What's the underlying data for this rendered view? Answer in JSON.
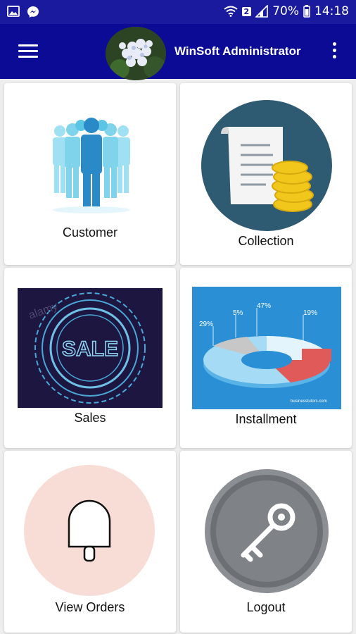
{
  "status_bar": {
    "battery": "70%",
    "time": "14:18",
    "sim_badge": "2"
  },
  "app_bar": {
    "title": "WinSoft Administrator"
  },
  "tiles": {
    "customer": {
      "label": "Customer"
    },
    "collection": {
      "label": "Collection"
    },
    "sales": {
      "label": "Sales",
      "image_text": "SALE",
      "watermark": "alamy"
    },
    "installment": {
      "label": "Installment",
      "percents": [
        "29%",
        "5%",
        "47%",
        "19%"
      ],
      "footer": "businesstutors.com"
    },
    "view_orders": {
      "label": "View Orders"
    },
    "logout": {
      "label": "Logout"
    }
  },
  "colors": {
    "status_bar": "#1a1a9e",
    "app_bar": "#0b0b96",
    "collection_circle": "#2e5a72",
    "view_orders_circle": "#f8ddd6",
    "sales_bg": "#1c1640",
    "installment_bg": "#2a8fd4",
    "coin": "#f2c71c"
  },
  "icons": [
    "image-icon",
    "messenger-icon",
    "wifi-icon",
    "signal-icon",
    "battery-icon",
    "menu-icon",
    "more-vert-icon",
    "key-icon",
    "bell-icon"
  ]
}
